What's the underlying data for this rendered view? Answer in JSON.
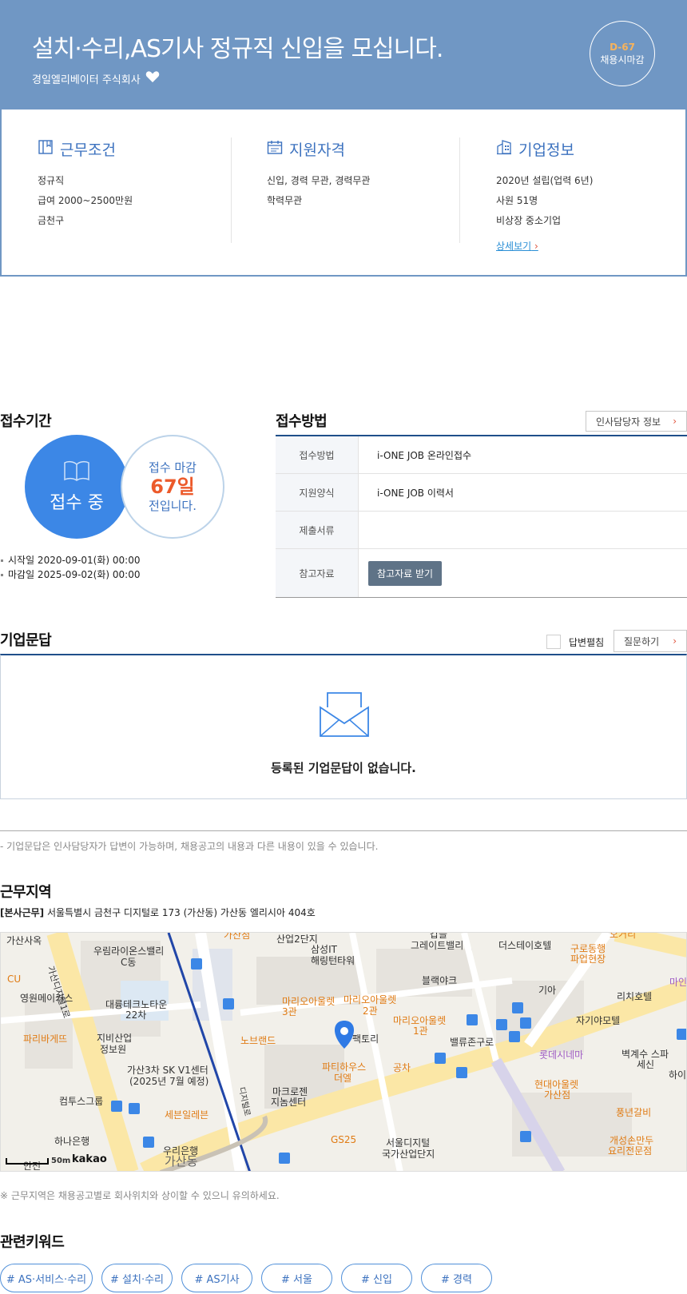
{
  "header": {
    "title": "설치·수리,AS기사 정규직 신입을 모십니다.",
    "company": "경일엘리베이터 주식회사",
    "dday": "D-67",
    "deadline_label": "채용시마감"
  },
  "summary": {
    "work": {
      "title": "근무조건",
      "lines": [
        "정규직",
        "급여 2000~2500만원",
        "금천구"
      ]
    },
    "qualify": {
      "title": "지원자격",
      "lines": [
        "신입, 경력 무관, 경력무관",
        "학력무관"
      ]
    },
    "company": {
      "title": "기업정보",
      "lines": [
        "2020년 설립(업력 6년)",
        "사원 51명",
        "비상장 중소기업"
      ],
      "detail_link": "상세보기"
    }
  },
  "period": {
    "title": "접수기간",
    "status": "접수 중",
    "deadline_prefix": "접수 마감",
    "deadline_days": "67일",
    "deadline_suffix": "전입니다.",
    "start": "시작일 2020-09-01(화) 00:00",
    "end": "마감일 2025-09-02(화) 00:00"
  },
  "method": {
    "title": "접수방법",
    "hr_button": "인사담당자 정보",
    "rows": [
      {
        "label": "접수방법",
        "value": "i-ONE JOB 온라인접수"
      },
      {
        "label": "지원양식",
        "value": "i-ONE JOB 이력서"
      },
      {
        "label": "제출서류",
        "value": ""
      },
      {
        "label": "참고자료",
        "value": ""
      }
    ],
    "ref_button": "참고자료 받기"
  },
  "qna": {
    "title": "기업문답",
    "collapse_label": "답변펼침",
    "ask_button": "질문하기",
    "empty": "등록된 기업문답이 없습니다.",
    "note": "- 기업문답은 인사담당자가 답변이 가능하며, 채용공고의 내용과 다른 내용이 있을 수 있습니다."
  },
  "location": {
    "title": "근무지역",
    "tag": "[본사근무]",
    "address": "서울특별시 금천구 디지털로 173 (가산동) 가산동 엘리시아 404호",
    "note": "※ 근무지역은 채용공고별로 회사위치와 상이할 수 있으니 유의하세요.",
    "scale": "50m",
    "provider": "kakao",
    "labels": {
      "l1": "가산사옥",
      "l2": "우림라이온스밸리",
      "l2b": "C동",
      "l3": "가산디지털1로",
      "l4": "CU",
      "l5": "영원메이커스",
      "l6": "대륭테크노타운",
      "l6b": "22차",
      "l7": "파리바게뜨",
      "l8": "지비산업",
      "l8b": "정보원",
      "l9": "가산3차 SK V1센터",
      "l9b": "(2025년 7월 예정)",
      "l10": "컴투스그룹",
      "l11": "하나은행",
      "l12": "세븐일레븐",
      "l13": "우리은행",
      "l14": "가산동",
      "l15": "삼성IT",
      "l15b": "해링턴타워",
      "l16": "마리오아울렛",
      "l16b": "3관",
      "l17": "마리오아울렛",
      "l17b": "2관",
      "l18": "노브랜드",
      "l19": "파티하우스",
      "l19b": "더엘",
      "l20": "마크로젠",
      "l20b": "지놈센터",
      "l21": "GS25",
      "l22": "서울디지털",
      "l22b": "국가산업단지",
      "l23": "블랙야크",
      "l24": "그레이트밸리",
      "l25": "마리오아울렛",
      "l25b": "1관",
      "l26": "밸류존구로",
      "l27": "공차",
      "l28": "더스테이호텔",
      "l29": "구로동행",
      "l29b": "파업현장",
      "l30": "기아",
      "l31": "리치호텔",
      "l32": "자기야모텔",
      "l33": "롯데시네마",
      "l34": "벽계수 스파",
      "l34b": "세신",
      "l35": "현대아울렛",
      "l35b": "가산점",
      "l36": "풍년갈비",
      "l37": "개성손만두",
      "l37b": "요리전문점",
      "l38": "갑을",
      "l39": "산업2단지",
      "l40": "가산점",
      "l41": "디지털로",
      "l42": "오거리",
      "l43": "마인",
      "l44": "하이",
      "l45": "팩토리",
      "l46": "안전"
    }
  },
  "keywords": {
    "title": "관련키워드",
    "items": [
      "# AS·서비스·수리",
      "# 설치·수리",
      "# AS기사",
      "# 서울",
      "# 신입",
      "# 경력"
    ]
  },
  "colors": {
    "header_bg": "#7097c4",
    "accent": "#3c87e6",
    "deadline": "#ec5a2b",
    "table_top": "#1f4f8a"
  }
}
